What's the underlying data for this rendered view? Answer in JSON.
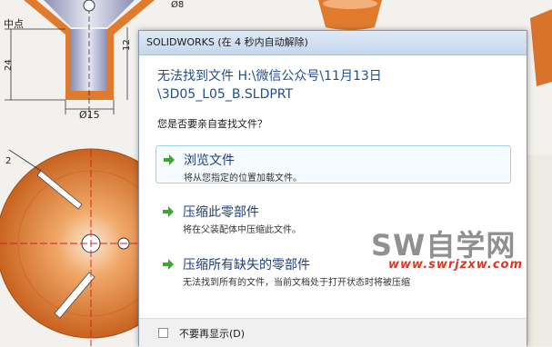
{
  "dialog": {
    "title": "SOLIDWORKS (在 4 秒内自动解除)",
    "main_instruction_line1": "无法找到文件 H:\\微信公众号\\11月13日",
    "main_instruction_line2": "\\3D05_L05_B.SLDPRT",
    "content": "您是否要亲自查找文件？",
    "commands": [
      {
        "title": "浏览文件",
        "desc": "将从您指定的位置加载文件。"
      },
      {
        "title": "压缩此零部件",
        "desc": "将在父装配体中压缩此文件。"
      },
      {
        "title": "压缩所有缺失的零部件",
        "desc": "无法找到所有的文件，当前文档处于打开状态时将被压缩"
      }
    ],
    "footer_checkbox_label": "不要再显示(D)"
  },
  "drawing": {
    "label_midpoint": "中点",
    "dim_24": "24",
    "dim_12": "12",
    "dim_diam15": "Ø15",
    "dim_2": "2",
    "dim_phi_top": "Ø8"
  },
  "watermark": {
    "text": "SW自学网",
    "url": "www.swrjzxw.com"
  },
  "colors": {
    "part_orange": "#e07b2e",
    "arrow_green": "#3aa82c",
    "link_blue": "#1f4e8c"
  }
}
